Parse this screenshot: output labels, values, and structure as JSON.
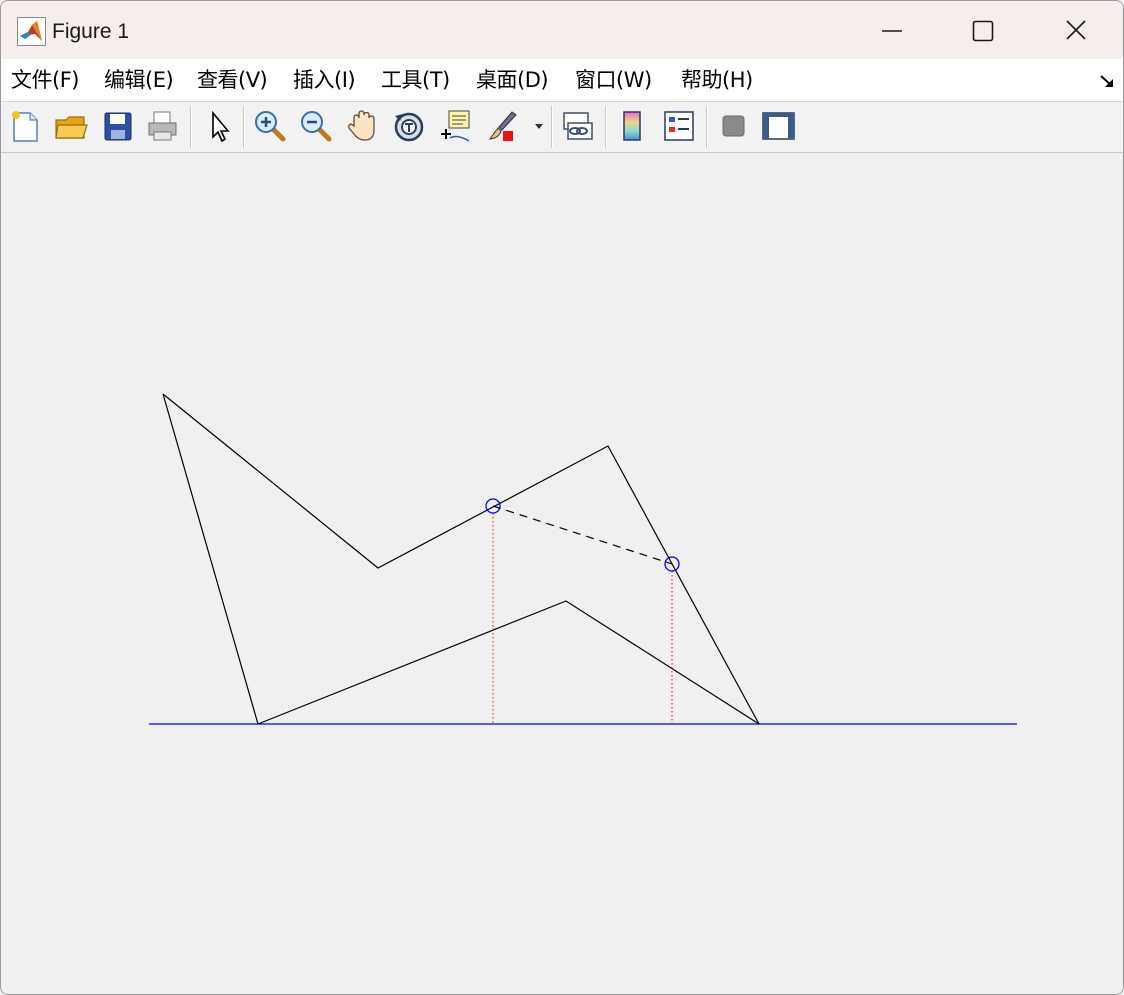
{
  "window": {
    "title": "Figure 1",
    "icon": "matlab-logo-icon",
    "controls": [
      "minimize-icon",
      "maximize-icon",
      "close-icon"
    ]
  },
  "menu": {
    "items": [
      {
        "label": "文件(F)"
      },
      {
        "label": "编辑(E)"
      },
      {
        "label": "查看(V)"
      },
      {
        "label": "插入(I)"
      },
      {
        "label": "工具(T)"
      },
      {
        "label": "桌面(D)"
      },
      {
        "label": "窗口(W)"
      },
      {
        "label": "帮助(H)"
      }
    ],
    "dock_icon": "dock-arrow-icon"
  },
  "toolbar": {
    "buttons": [
      "new-figure-icon",
      "open-file-icon",
      "save-icon",
      "print-icon",
      "edit-plot-pointer-icon",
      "zoom-in-icon",
      "zoom-out-icon",
      "pan-hand-icon",
      "rotate-3d-icon",
      "data-cursor-icon",
      "brush-icon",
      "brush-dropdown-icon",
      "link-plot-icon",
      "colorbar-icon",
      "legend-icon",
      "hide-plot-tools-icon",
      "show-plot-tools-icon"
    ]
  },
  "plot": {
    "colors": {
      "baseline": "#0000ff",
      "polyline": "#000000",
      "markers": "#0000ff",
      "dropline": "#ff0000",
      "connector": "#000000"
    }
  }
}
